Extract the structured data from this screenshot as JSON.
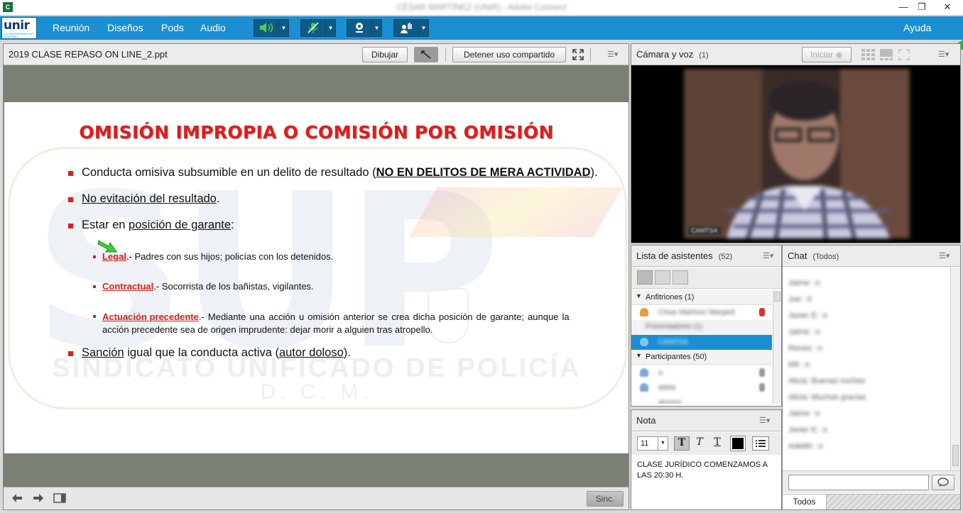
{
  "window": {
    "title": "CÉSAR MARTÍNEZ (UNIR) - Adobe Connect",
    "minimize": "—",
    "restore": "❐",
    "close": "✕",
    "app_icon": "C"
  },
  "logo": {
    "text": "unir",
    "tagline": "LA UNIVERSIDAD EN INTERNET"
  },
  "menu": {
    "items": [
      "Reunión",
      "Diseños",
      "Pods",
      "Audio"
    ],
    "help": "Ayuda"
  },
  "toolbar_icons": [
    "speaker-icon",
    "microphone-muted-icon",
    "webcam-icon",
    "raise-hand-icon"
  ],
  "share": {
    "title": "2019 CLASE REPASO ON LINE_2.ppt",
    "draw_button": "Dibujar",
    "stop_share_button": "Detener uso compartido",
    "sync_button": "Sinc."
  },
  "slide": {
    "title": "OMISIÓN IMPROPIA O COMISIÓN POR OMISIÓN",
    "bullet1_pre": "Conducta omisiva subsumible en un delito de resultado (",
    "bullet1_em": "NO EN DELITOS DE MERA ACTIVIDAD",
    "bullet1_post": ").",
    "bullet2": "No evitación del resultado",
    "bullet2_post": ".",
    "bullet3_pre": "Estar en ",
    "bullet3_link": "posición de garante",
    "bullet3_post": ":",
    "sub1_label": "Legal",
    "sub1_text": ".- Padres con sus hijos; policías con los detenidos.",
    "sub2_label": "Contractual",
    "sub2_text": ".- Socorrista de los bañistas, vigilantes.",
    "sub3_label": "Actuación precedente",
    "sub3_text_line1": ".- Mediante una acción u omisión anterior se crea dicha posición de garante; aunque la",
    "sub3_text_line2": "acción precedente sea de origen imprudente: dejar morir a alguien tras atropello.",
    "bullet4_a": "Sanción",
    "bullet4_b": " igual que la conducta activa (",
    "bullet4_c": "autor doloso",
    "bullet4_d": ").",
    "watermark_big": "SUP",
    "watermark_line1": "SINDICATO UNIFICADO DE POLICÍA",
    "watermark_line2": "D. C. M."
  },
  "camera": {
    "title": "Cámara y voz",
    "count": "(1)",
    "start_button": "Iniciar",
    "name_tag": "CAMTSA"
  },
  "attendees": {
    "title": "Lista de asistentes",
    "count": "(52)",
    "hosts_label": "Anfitriones (1)",
    "host_name": "César Martínez Margarit",
    "presenters_label": "Presentadores (1)",
    "presenter_name": "CAMTSA",
    "participants_label": "Participantes (50)",
    "participants": [
      "a",
      "adela",
      "alumno"
    ]
  },
  "note": {
    "title": "Nota",
    "font_size": "11",
    "text": "CLASE JURÍDICO COMENZAMOS A LAS 20:30 H."
  },
  "chat": {
    "title": "Chat",
    "scope": "(Todos)",
    "messages": [
      "Jaime: :o",
      "Joe: :0",
      "Javier E: :o",
      "Jaime: :o",
      "Renee: :o",
      "Mit: :o",
      "Alicia: Buenas noches",
      "Alicia: Muchas gracias",
      "Jaime: :o",
      "Javier E: :o",
      "Adelith: :o"
    ],
    "tab": "Todos"
  },
  "colors": {
    "accent": "#1b8fd1",
    "title_red": "#e21b1b",
    "selected": "#1b8fd1"
  }
}
